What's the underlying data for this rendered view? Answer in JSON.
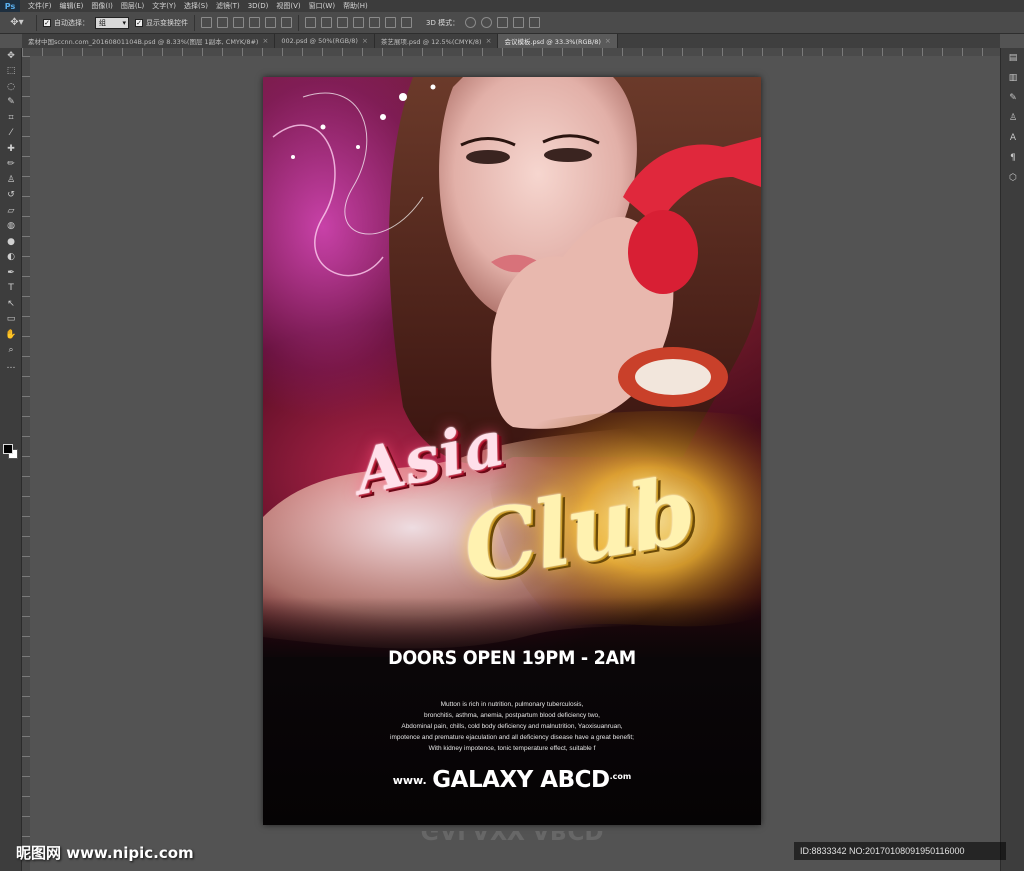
{
  "app": {
    "logo": "Ps",
    "menu": [
      "文件(F)",
      "编辑(E)",
      "图像(I)",
      "图层(L)",
      "文字(Y)",
      "选择(S)",
      "滤镜(T)",
      "3D(D)",
      "视图(V)",
      "窗口(W)",
      "帮助(H)"
    ]
  },
  "options": {
    "auto_select_label": "自动选择：",
    "auto_select_value": "组",
    "show_transform_label": "显示变换控件",
    "mode3d_label": "3D 模式："
  },
  "tabs": [
    {
      "label": "素材中国sccnn.com_20160801104B.psd @ 8.33%(图层 1副本, CMYK/8#)",
      "close": "×"
    },
    {
      "label": "002.psd @ 50%(RGB/8)",
      "close": "×"
    },
    {
      "label": "茶艺展项.psd @ 12.5%(CMYK/8)",
      "close": "×"
    },
    {
      "label": "会议模板.psd @ 33.3%(RGB/8)",
      "close": "×"
    }
  ],
  "poster": {
    "title_line1": "Asia",
    "title_line2": "Club",
    "doors": "DOORS OPEN 19PM - 2AM",
    "blurb": [
      "Mutton is rich in nutrition, pulmonary tuberculosis,",
      "bronchitis, asthma, anemia, postpartum blood deficiency two,",
      "Abdominal pain, chills, cold body deficiency and malnutrition, Yaoxisuanruan,",
      "impotence and premature ejaculation and all deficiency disease have a great benefit;",
      "With kidney impotence, tonic temperature effect, suitable f"
    ],
    "web_prefix": "www.",
    "web_name": "GALAXY ABCD",
    "web_suffix": ".com"
  },
  "reflection_text": "GALAXY ABCD",
  "watermark": {
    "left": "昵图网 www.nipic.com",
    "right": "ID:8833342 NO:20170108091950116000"
  },
  "colors": {
    "workspace": "#535353",
    "asia_title": "#ffe0ea",
    "club_title": "#fff2b0"
  }
}
